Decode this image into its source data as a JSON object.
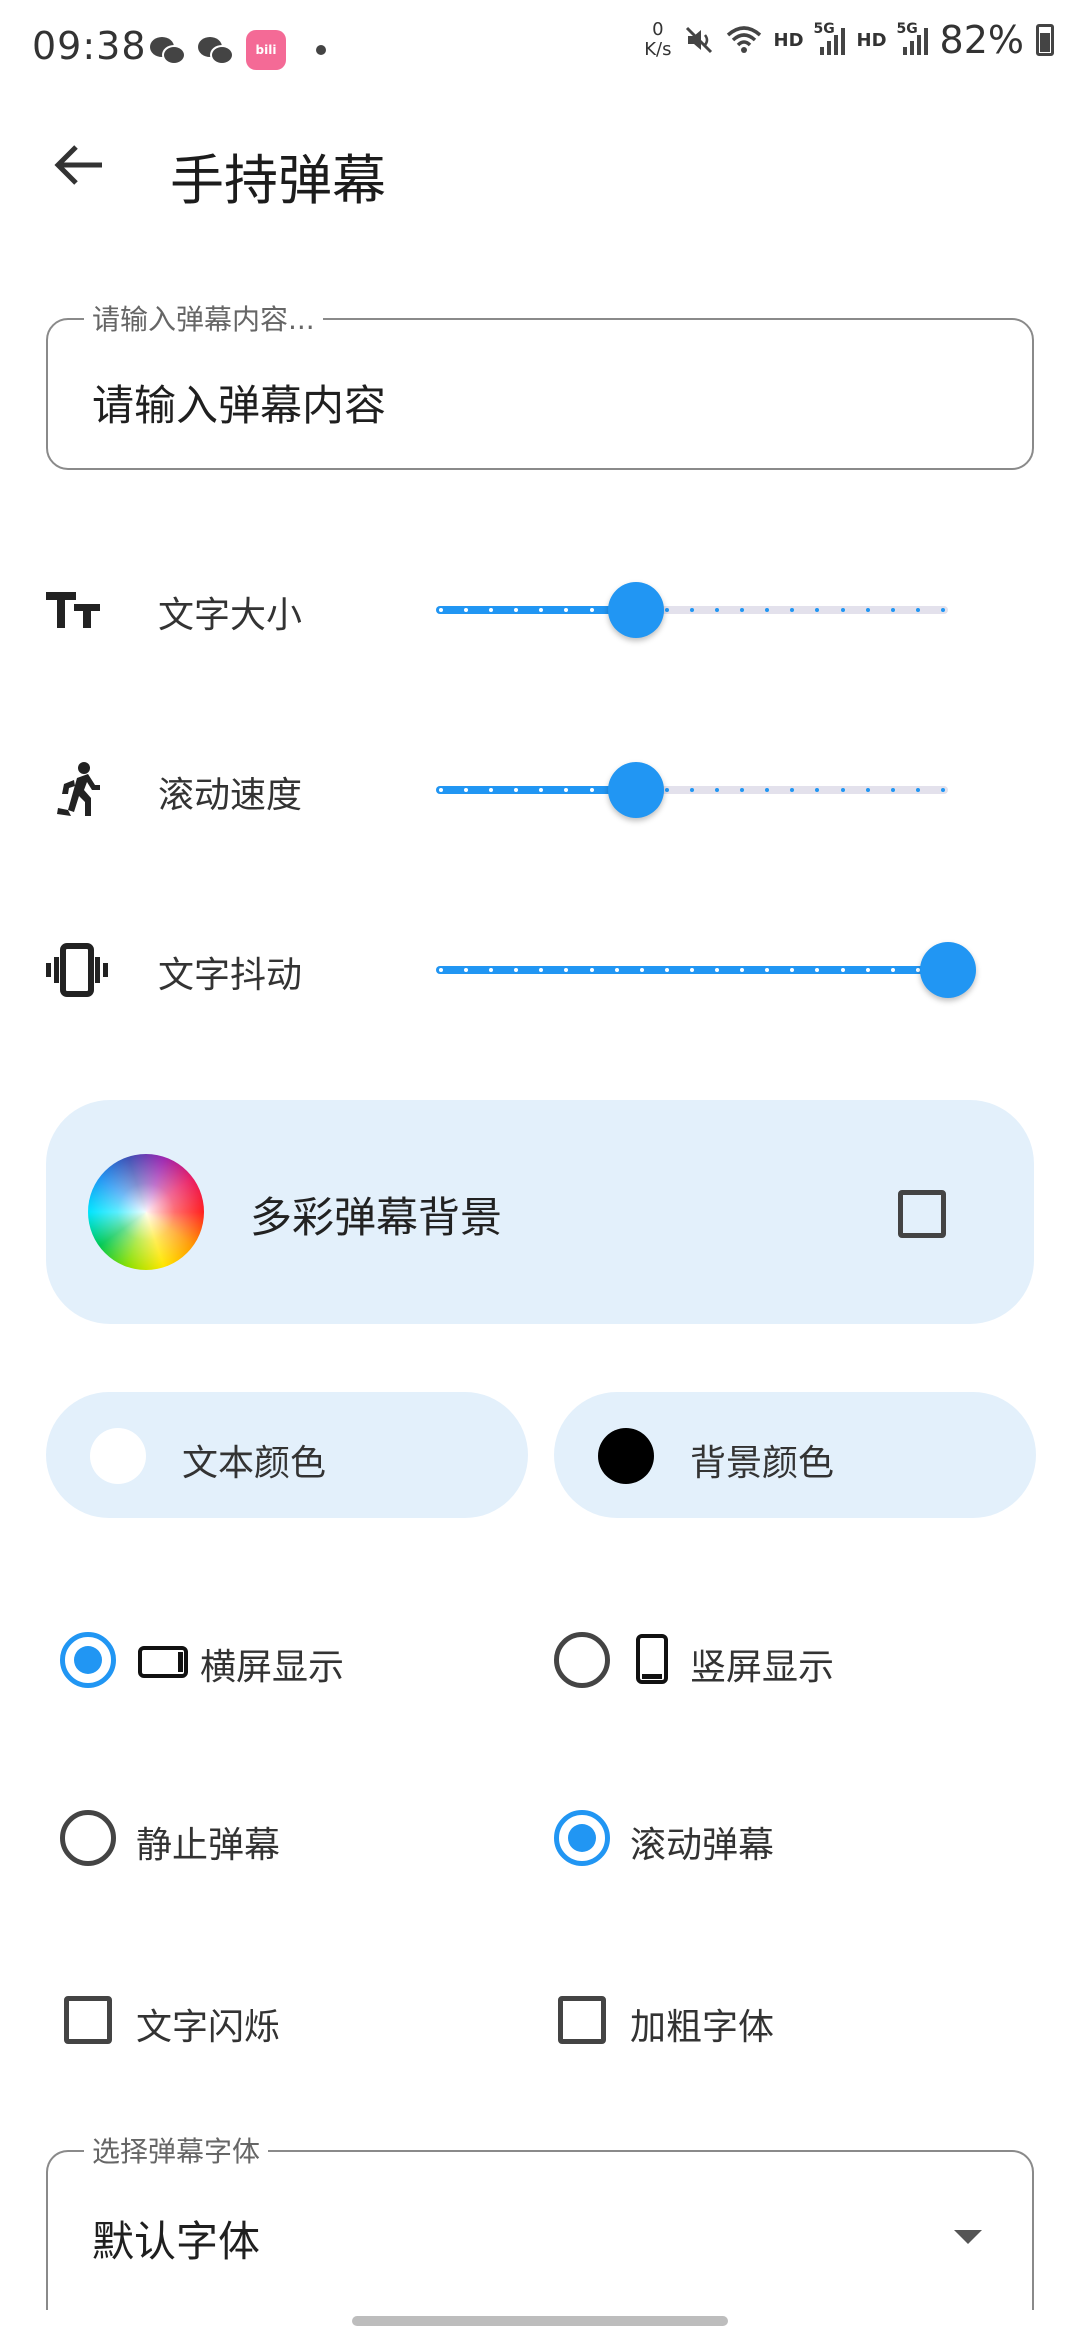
{
  "status_bar": {
    "time": "09:38",
    "net_speed_value": "0",
    "net_speed_unit": "K/s",
    "hd1": "HD",
    "hd2": "HD",
    "net_type1": "5G",
    "net_type2": "5G",
    "app_icon_text": "bili",
    "battery": "82%"
  },
  "app_bar": {
    "title": "手持弹幕"
  },
  "text_input": {
    "legend": "请输入弹幕内容...",
    "value": "请输入弹幕内容"
  },
  "sliders": [
    {
      "label": "文字大小",
      "icon": "text-size-icon",
      "value_fraction": 0.39,
      "ticks": 20
    },
    {
      "label": "滚动速度",
      "icon": "running-person-icon",
      "value_fraction": 0.39,
      "ticks": 20
    },
    {
      "label": "文字抖动",
      "icon": "vibration-icon",
      "value_fraction": 1.0,
      "ticks": 20
    }
  ],
  "colorful_bg": {
    "label": "多彩弹幕背景",
    "checked": false
  },
  "text_color": {
    "label": "文本颜色",
    "color": "#ffffff"
  },
  "bg_color": {
    "label": "背景颜色",
    "color": "#000000"
  },
  "orientation": {
    "landscape": {
      "label": "横屏显示",
      "selected": true
    },
    "portrait": {
      "label": "竖屏显示",
      "selected": false
    }
  },
  "mode": {
    "static": {
      "label": "静止弹幕",
      "selected": false
    },
    "scroll": {
      "label": "滚动弹幕",
      "selected": true
    }
  },
  "options": {
    "blink": {
      "label": "文字闪烁",
      "checked": false
    },
    "bold": {
      "label": "加粗字体",
      "checked": false
    }
  },
  "font_select": {
    "legend": "选择弹幕字体",
    "value": "默认字体"
  },
  "colors": {
    "accent": "#2196f3",
    "card_bg": "#e3f0fb",
    "track_inactive": "#e3e1ec"
  }
}
